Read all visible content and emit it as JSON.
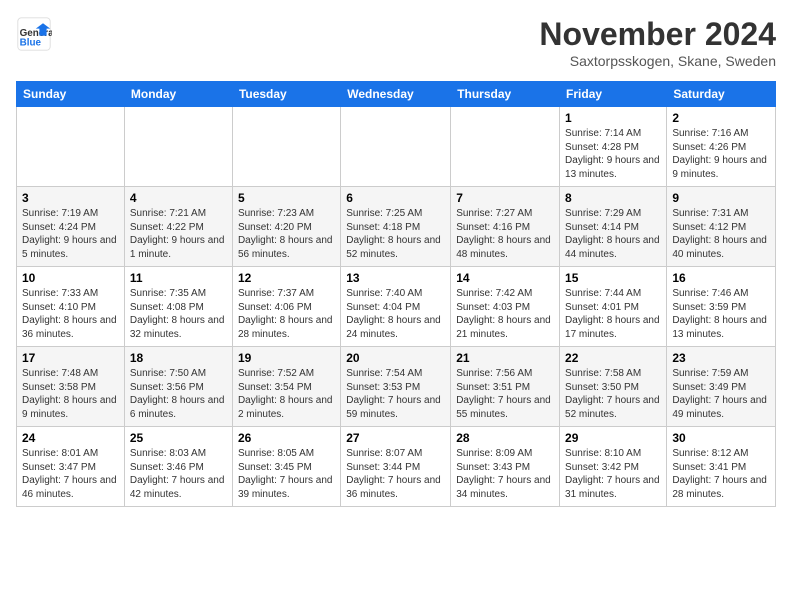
{
  "logo": {
    "general": "General",
    "blue": "Blue"
  },
  "title": "November 2024",
  "location": "Saxtorpsskogen, Skane, Sweden",
  "days_of_week": [
    "Sunday",
    "Monday",
    "Tuesday",
    "Wednesday",
    "Thursday",
    "Friday",
    "Saturday"
  ],
  "weeks": [
    [
      {
        "day": "",
        "info": ""
      },
      {
        "day": "",
        "info": ""
      },
      {
        "day": "",
        "info": ""
      },
      {
        "day": "",
        "info": ""
      },
      {
        "day": "",
        "info": ""
      },
      {
        "day": "1",
        "info": "Sunrise: 7:14 AM\nSunset: 4:28 PM\nDaylight: 9 hours and 13 minutes."
      },
      {
        "day": "2",
        "info": "Sunrise: 7:16 AM\nSunset: 4:26 PM\nDaylight: 9 hours and 9 minutes."
      }
    ],
    [
      {
        "day": "3",
        "info": "Sunrise: 7:19 AM\nSunset: 4:24 PM\nDaylight: 9 hours and 5 minutes."
      },
      {
        "day": "4",
        "info": "Sunrise: 7:21 AM\nSunset: 4:22 PM\nDaylight: 9 hours and 1 minute."
      },
      {
        "day": "5",
        "info": "Sunrise: 7:23 AM\nSunset: 4:20 PM\nDaylight: 8 hours and 56 minutes."
      },
      {
        "day": "6",
        "info": "Sunrise: 7:25 AM\nSunset: 4:18 PM\nDaylight: 8 hours and 52 minutes."
      },
      {
        "day": "7",
        "info": "Sunrise: 7:27 AM\nSunset: 4:16 PM\nDaylight: 8 hours and 48 minutes."
      },
      {
        "day": "8",
        "info": "Sunrise: 7:29 AM\nSunset: 4:14 PM\nDaylight: 8 hours and 44 minutes."
      },
      {
        "day": "9",
        "info": "Sunrise: 7:31 AM\nSunset: 4:12 PM\nDaylight: 8 hours and 40 minutes."
      }
    ],
    [
      {
        "day": "10",
        "info": "Sunrise: 7:33 AM\nSunset: 4:10 PM\nDaylight: 8 hours and 36 minutes."
      },
      {
        "day": "11",
        "info": "Sunrise: 7:35 AM\nSunset: 4:08 PM\nDaylight: 8 hours and 32 minutes."
      },
      {
        "day": "12",
        "info": "Sunrise: 7:37 AM\nSunset: 4:06 PM\nDaylight: 8 hours and 28 minutes."
      },
      {
        "day": "13",
        "info": "Sunrise: 7:40 AM\nSunset: 4:04 PM\nDaylight: 8 hours and 24 minutes."
      },
      {
        "day": "14",
        "info": "Sunrise: 7:42 AM\nSunset: 4:03 PM\nDaylight: 8 hours and 21 minutes."
      },
      {
        "day": "15",
        "info": "Sunrise: 7:44 AM\nSunset: 4:01 PM\nDaylight: 8 hours and 17 minutes."
      },
      {
        "day": "16",
        "info": "Sunrise: 7:46 AM\nSunset: 3:59 PM\nDaylight: 8 hours and 13 minutes."
      }
    ],
    [
      {
        "day": "17",
        "info": "Sunrise: 7:48 AM\nSunset: 3:58 PM\nDaylight: 8 hours and 9 minutes."
      },
      {
        "day": "18",
        "info": "Sunrise: 7:50 AM\nSunset: 3:56 PM\nDaylight: 8 hours and 6 minutes."
      },
      {
        "day": "19",
        "info": "Sunrise: 7:52 AM\nSunset: 3:54 PM\nDaylight: 8 hours and 2 minutes."
      },
      {
        "day": "20",
        "info": "Sunrise: 7:54 AM\nSunset: 3:53 PM\nDaylight: 7 hours and 59 minutes."
      },
      {
        "day": "21",
        "info": "Sunrise: 7:56 AM\nSunset: 3:51 PM\nDaylight: 7 hours and 55 minutes."
      },
      {
        "day": "22",
        "info": "Sunrise: 7:58 AM\nSunset: 3:50 PM\nDaylight: 7 hours and 52 minutes."
      },
      {
        "day": "23",
        "info": "Sunrise: 7:59 AM\nSunset: 3:49 PM\nDaylight: 7 hours and 49 minutes."
      }
    ],
    [
      {
        "day": "24",
        "info": "Sunrise: 8:01 AM\nSunset: 3:47 PM\nDaylight: 7 hours and 46 minutes."
      },
      {
        "day": "25",
        "info": "Sunrise: 8:03 AM\nSunset: 3:46 PM\nDaylight: 7 hours and 42 minutes."
      },
      {
        "day": "26",
        "info": "Sunrise: 8:05 AM\nSunset: 3:45 PM\nDaylight: 7 hours and 39 minutes."
      },
      {
        "day": "27",
        "info": "Sunrise: 8:07 AM\nSunset: 3:44 PM\nDaylight: 7 hours and 36 minutes."
      },
      {
        "day": "28",
        "info": "Sunrise: 8:09 AM\nSunset: 3:43 PM\nDaylight: 7 hours and 34 minutes."
      },
      {
        "day": "29",
        "info": "Sunrise: 8:10 AM\nSunset: 3:42 PM\nDaylight: 7 hours and 31 minutes."
      },
      {
        "day": "30",
        "info": "Sunrise: 8:12 AM\nSunset: 3:41 PM\nDaylight: 7 hours and 28 minutes."
      }
    ]
  ]
}
